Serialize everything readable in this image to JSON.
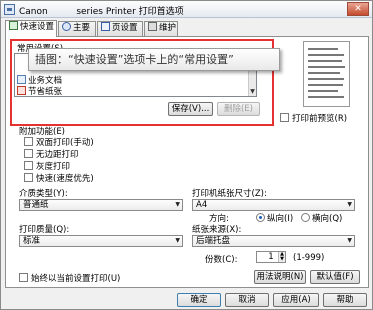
{
  "window": {
    "title": "Canon          series Printer 打印首选项",
    "close": "✕"
  },
  "tabs": [
    "快速设置",
    "主要",
    "页设置",
    "维护"
  ],
  "common_settings": {
    "label": "常用设置(S)",
    "items": [
      "业务文档",
      "节省纸张"
    ],
    "save_button": "保存(V)...",
    "delete_button": "删除(E)"
  },
  "callout": "插图：“快速设置”选项卡上的“常用设置”",
  "print_preview": "打印前预览(R)",
  "extra_features": {
    "label": "附加功能(E)",
    "items": [
      "双面打印(手动)",
      "无边距打印",
      "灰度打印",
      "快速(速度优先)"
    ]
  },
  "media_type": {
    "label": "介质类型(Y):",
    "value": "普通纸"
  },
  "paper_size": {
    "label": "打印机纸张尺寸(Z):",
    "value": "A4"
  },
  "orientation": {
    "label": "方向:",
    "portrait": "纵向(I)",
    "landscape": "横向(Q)",
    "selected": "portrait"
  },
  "print_quality": {
    "label": "打印质量(Q):",
    "value": "标准"
  },
  "paper_source": {
    "label": "纸张来源(X):",
    "value": "后端托盘"
  },
  "copies": {
    "label": "份数(C):",
    "value": "1",
    "range": "(1-999)"
  },
  "always_print_current": "始终以当前设置打印(U)",
  "instructions_button": "用法说明(N)",
  "defaults_button": "默认值(F)",
  "footer": {
    "ok": "确定",
    "cancel": "取消",
    "apply": "应用(A)",
    "help": "帮助"
  }
}
